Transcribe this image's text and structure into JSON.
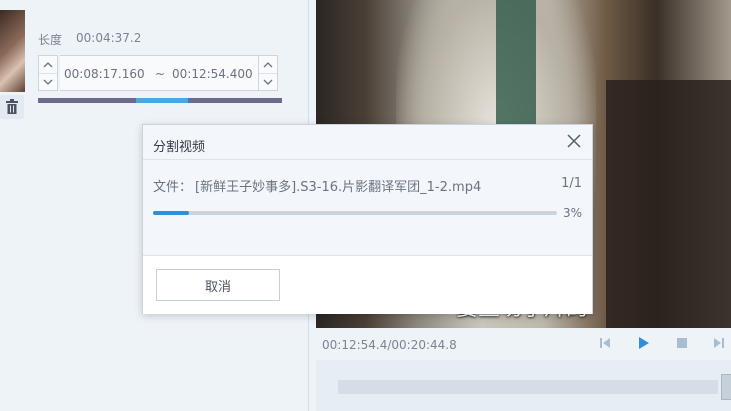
{
  "clip": {
    "length_label": "长度",
    "length_value": "00:04:37.2",
    "start_time": "00:08:17.160",
    "separator": "~",
    "end_time": "00:12:54.400"
  },
  "video": {
    "subtitle": "要些切了片的"
  },
  "player": {
    "time": "00:12:54.4/00:20:44.8"
  },
  "dialog": {
    "title": "分割视频",
    "file_label": "文件：",
    "file_name": "[新鲜王子妙事多].S3-16.片影翻译军团_1-2.mp4",
    "file_count": "1/1",
    "progress": 0.03,
    "progress_text": "3%",
    "cancel_label": "取消"
  },
  "colors": {
    "accent": "#2f8fd8",
    "selection": "#4aa8e0"
  },
  "icons": [
    "trash-icon",
    "spin-up-icon",
    "spin-down-icon",
    "close-icon",
    "prev-icon",
    "play-icon",
    "stop-icon",
    "next-icon"
  ]
}
